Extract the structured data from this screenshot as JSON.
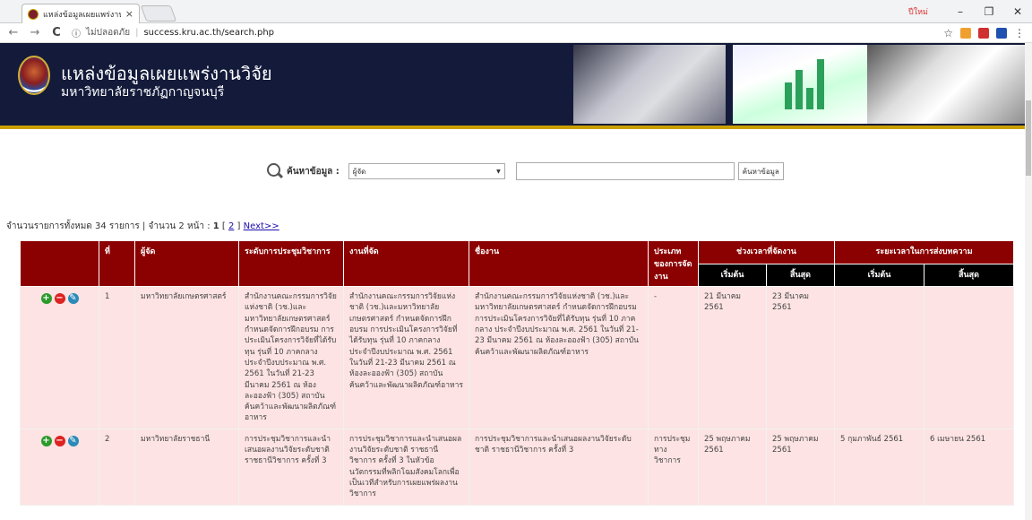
{
  "browser": {
    "tab_title": "แหล่งข้อมูลเผยแพร่งานวิจัย -",
    "tab_close": "×",
    "user_label": "ปีใหม่",
    "win_minimize": "–",
    "win_maximize": "❐",
    "win_close": "✕",
    "insecure_label": "ไม่ปลอดภัย",
    "url": "success.kru.ac.th/search.php",
    "info_symbol": "ⓘ",
    "star_symbol": "☆",
    "back_symbol": "←",
    "forward_symbol": "→",
    "reload_symbol": "C",
    "menu_symbol": "⋮"
  },
  "header": {
    "title": "แหล่งข้อมูลเผยแพร่งานวิจัย",
    "subtitle": "มหาวิทยาลัยราชภัฏกาญจนบุรี"
  },
  "search": {
    "label": "ค้นหาข้อมูล :",
    "selected": "ผู้จัด",
    "arrow": "▼",
    "button": "ค้นหาข้อมูล"
  },
  "summary": {
    "text1": "จำนวนรายการทั้งหมด 34 รายการ | จำนวน 2 หน้า : ",
    "current_page": "1",
    "bracket_open": " [ ",
    "page2": "2",
    "bracket_close": " ] ",
    "next": "Next>>"
  },
  "table": {
    "headers": {
      "no": "ที่",
      "organizer": "ผู้จัด",
      "level": "ระดับการประชุมวิชาการ",
      "event": "งานที่จัด",
      "title": "ชื่องาน",
      "type": "ประเภทของการจัดงาน",
      "period": "ช่วงเวลาที่จัดงาน",
      "submission": "ระยะเวลาในการส่งบทความ",
      "start": "เริ่มต้น",
      "end": "สิ้นสุด"
    },
    "rows": [
      {
        "no": "1",
        "organizer": "มหาวิทยาลัยเกษตรศาสตร์",
        "level": "สำนักงานคณะกรรมการวิจัยแห่งชาติ (วช.)และมหาวิทยาลัยเกษตรศาสตร์ กำหนดจัดการฝึกอบรม การประเมินโครงการวิจัยที่ได้รับทุน รุ่นที่ 10 ภาคกลาง ประจำปีงบประมาณ พ.ศ. 2561 ในวันที่ 21-23 มีนาคม 2561 ณ ห้องละอองฟ้า (305) สถาบันค้นคว้าและพัฒนาผลิตภัณฑ์อาหาร",
        "event": "สำนักงานคณะกรรมการวิจัยแห่งชาติ (วช.)และมหาวิทยาลัยเกษตรศาสตร์ กำหนดจัดการฝึกอบรม การประเมินโครงการวิจัยที่ได้รับทุน รุ่นที่ 10 ภาคกลาง ประจำปีงบประมาณ พ.ศ. 2561 ในวันที่ 21-23 มีนาคม 2561 ณ ห้องละอองฟ้า (305) สถาบันค้นคว้าและพัฒนาผลิตภัณฑ์อาหาร",
        "title": "สำนักงานคณะกรรมการวิจัยแห่งชาติ (วช.)และมหาวิทยาลัยเกษตรศาสตร์ กำหนดจัดการฝึกอบรม การประเมินโครงการวิจัยที่ได้รับทุน รุ่นที่ 10 ภาคกลาง ประจำปีงบประมาณ พ.ศ. 2561 ในวันที่ 21-23 มีนาคม 2561 ณ ห้องละอองฟ้า (305) สถาบันค้นคว้าและพัฒนาผลิตภัณฑ์อาหาร",
        "type": "-",
        "start": "21 มีนาคม 2561",
        "end": "23 มีนาคม 2561",
        "sub_start": "",
        "sub_end": ""
      },
      {
        "no": "2",
        "organizer": "มหาวิทยาลัยราชธานี",
        "level": "การประชุมวิชาการและนำเสนอผลงานวิจัยระดับชาติ ราชธานีวิชาการ ครั้งที่ 3",
        "event": "การประชุมวิชาการและนำเสนอผลงานวิจัยระดับชาติ ราชธานีวิชาการ ครั้งที่ 3 ในหัวข้อ นวัตกรรมที่พลิกโฉมสังคมโลกเพื่อเป็นเวทีสำหรับการเผยแพร่ผลงานวิชาการ",
        "title": "การประชุมวิชาการและนำเสนอผลงานวิจัยระดับชาติ ราชธานีวิชาการ ครั้งที่ 3",
        "type": "การประชุมทางวิชาการ",
        "start": "25 พฤษภาคม 2561",
        "end": "25 พฤษภาคม 2561",
        "sub_start": "5 กุมภาพันธ์ 2561",
        "sub_end": "6 เมษายน 2561"
      }
    ]
  },
  "colors": {
    "header_bg": "#131a3a",
    "table_header": "#8b0000",
    "row_bg": "#fde3e3",
    "accent": "#c9a000"
  }
}
